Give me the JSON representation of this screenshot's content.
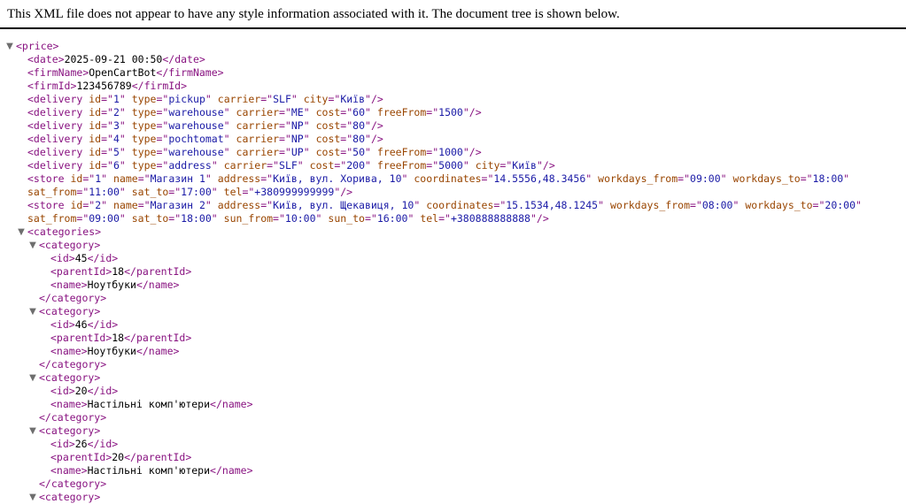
{
  "header": {
    "message": "This XML file does not appear to have any style information associated with it. The document tree is shown below."
  },
  "tree": [
    {
      "indent": 0,
      "toggle": "▼",
      "tag": "price",
      "kind": "open",
      "name": "xml-open-price"
    },
    {
      "indent": 1,
      "tag": "date",
      "text": "2025-09-21 00:50",
      "name": "xml-date"
    },
    {
      "indent": 1,
      "tag": "firmName",
      "text": "OpenCartBot",
      "name": "xml-firmname"
    },
    {
      "indent": 1,
      "tag": "firmId",
      "text": "123456789",
      "name": "xml-firmid"
    },
    {
      "indent": 1,
      "tag": "delivery",
      "selfClosing": true,
      "name": "xml-delivery",
      "attrs": [
        [
          "id",
          "1"
        ],
        [
          "type",
          "pickup"
        ],
        [
          "carrier",
          "SLF"
        ],
        [
          "city",
          "Київ"
        ]
      ]
    },
    {
      "indent": 1,
      "tag": "delivery",
      "selfClosing": true,
      "name": "xml-delivery",
      "attrs": [
        [
          "id",
          "2"
        ],
        [
          "type",
          "warehouse"
        ],
        [
          "carrier",
          "ME"
        ],
        [
          "cost",
          "60"
        ],
        [
          "freeFrom",
          "1500"
        ]
      ]
    },
    {
      "indent": 1,
      "tag": "delivery",
      "selfClosing": true,
      "name": "xml-delivery",
      "attrs": [
        [
          "id",
          "3"
        ],
        [
          "type",
          "warehouse"
        ],
        [
          "carrier",
          "NP"
        ],
        [
          "cost",
          "80"
        ]
      ]
    },
    {
      "indent": 1,
      "tag": "delivery",
      "selfClosing": true,
      "name": "xml-delivery",
      "attrs": [
        [
          "id",
          "4"
        ],
        [
          "type",
          "pochtomat"
        ],
        [
          "carrier",
          "NP"
        ],
        [
          "cost",
          "80"
        ]
      ]
    },
    {
      "indent": 1,
      "tag": "delivery",
      "selfClosing": true,
      "name": "xml-delivery",
      "attrs": [
        [
          "id",
          "5"
        ],
        [
          "type",
          "warehouse"
        ],
        [
          "carrier",
          "UP"
        ],
        [
          "cost",
          "50"
        ],
        [
          "freeFrom",
          "1000"
        ]
      ]
    },
    {
      "indent": 1,
      "tag": "delivery",
      "selfClosing": true,
      "name": "xml-delivery",
      "attrs": [
        [
          "id",
          "6"
        ],
        [
          "type",
          "address"
        ],
        [
          "carrier",
          "SLF"
        ],
        [
          "cost",
          "200"
        ],
        [
          "freeFrom",
          "5000"
        ],
        [
          "city",
          "Київ"
        ]
      ]
    },
    {
      "indent": 1,
      "tag": "store",
      "selfClosing": true,
      "name": "xml-store",
      "attrs": [
        [
          "id",
          "1"
        ],
        [
          "name",
          "Магазин 1"
        ],
        [
          "address",
          "Київ, вул. Хорива, 10"
        ],
        [
          "coordinates",
          "14.5556,48.3456"
        ],
        [
          "workdays_from",
          "09:00"
        ],
        [
          "workdays_to",
          "18:00"
        ],
        [
          "sat_from",
          "11:00"
        ],
        [
          "sat_to",
          "17:00"
        ],
        [
          "tel",
          "+380999999999"
        ]
      ]
    },
    {
      "indent": 1,
      "tag": "store",
      "selfClosing": true,
      "name": "xml-store",
      "attrs": [
        [
          "id",
          "2"
        ],
        [
          "name",
          "Магазин 2"
        ],
        [
          "address",
          "Київ, вул. Щекавиця, 10"
        ],
        [
          "coordinates",
          "15.1534,48.1245"
        ],
        [
          "workdays_from",
          "08:00"
        ],
        [
          "workdays_to",
          "20:00"
        ],
        [
          "sat_from",
          "09:00"
        ],
        [
          "sat_to",
          "18:00"
        ],
        [
          "sun_from",
          "10:00"
        ],
        [
          "sun_to",
          "16:00"
        ],
        [
          "tel",
          "+380888888888"
        ]
      ]
    },
    {
      "indent": 1,
      "toggle": "▼",
      "tag": "categories",
      "kind": "open",
      "name": "xml-open-categories"
    },
    {
      "indent": 2,
      "toggle": "▼",
      "tag": "category",
      "kind": "open",
      "name": "xml-open-category"
    },
    {
      "indent": 3,
      "tag": "id",
      "text": "45",
      "name": "xml-id"
    },
    {
      "indent": 3,
      "tag": "parentId",
      "text": "18",
      "name": "xml-parentid"
    },
    {
      "indent": 3,
      "tag": "name",
      "text": "Ноутбуки",
      "name": "xml-name"
    },
    {
      "indent": 2,
      "tag": "category",
      "kind": "close",
      "name": "xml-close-category"
    },
    {
      "indent": 2,
      "toggle": "▼",
      "tag": "category",
      "kind": "open",
      "name": "xml-open-category"
    },
    {
      "indent": 3,
      "tag": "id",
      "text": "46",
      "name": "xml-id"
    },
    {
      "indent": 3,
      "tag": "parentId",
      "text": "18",
      "name": "xml-parentid"
    },
    {
      "indent": 3,
      "tag": "name",
      "text": "Ноутбуки",
      "name": "xml-name"
    },
    {
      "indent": 2,
      "tag": "category",
      "kind": "close",
      "name": "xml-close-category"
    },
    {
      "indent": 2,
      "toggle": "▼",
      "tag": "category",
      "kind": "open",
      "name": "xml-open-category"
    },
    {
      "indent": 3,
      "tag": "id",
      "text": "20",
      "name": "xml-id"
    },
    {
      "indent": 3,
      "tag": "name",
      "text": "Настільні комп'ютери",
      "name": "xml-name"
    },
    {
      "indent": 2,
      "tag": "category",
      "kind": "close",
      "name": "xml-close-category"
    },
    {
      "indent": 2,
      "toggle": "▼",
      "tag": "category",
      "kind": "open",
      "name": "xml-open-category"
    },
    {
      "indent": 3,
      "tag": "id",
      "text": "26",
      "name": "xml-id"
    },
    {
      "indent": 3,
      "tag": "parentId",
      "text": "20",
      "name": "xml-parentid"
    },
    {
      "indent": 3,
      "tag": "name",
      "text": "Настільні комп'ютери",
      "name": "xml-name"
    },
    {
      "indent": 2,
      "tag": "category",
      "kind": "close",
      "name": "xml-close-category"
    },
    {
      "indent": 2,
      "toggle": "▼",
      "tag": "category",
      "kind": "open",
      "name": "xml-open-category"
    }
  ]
}
